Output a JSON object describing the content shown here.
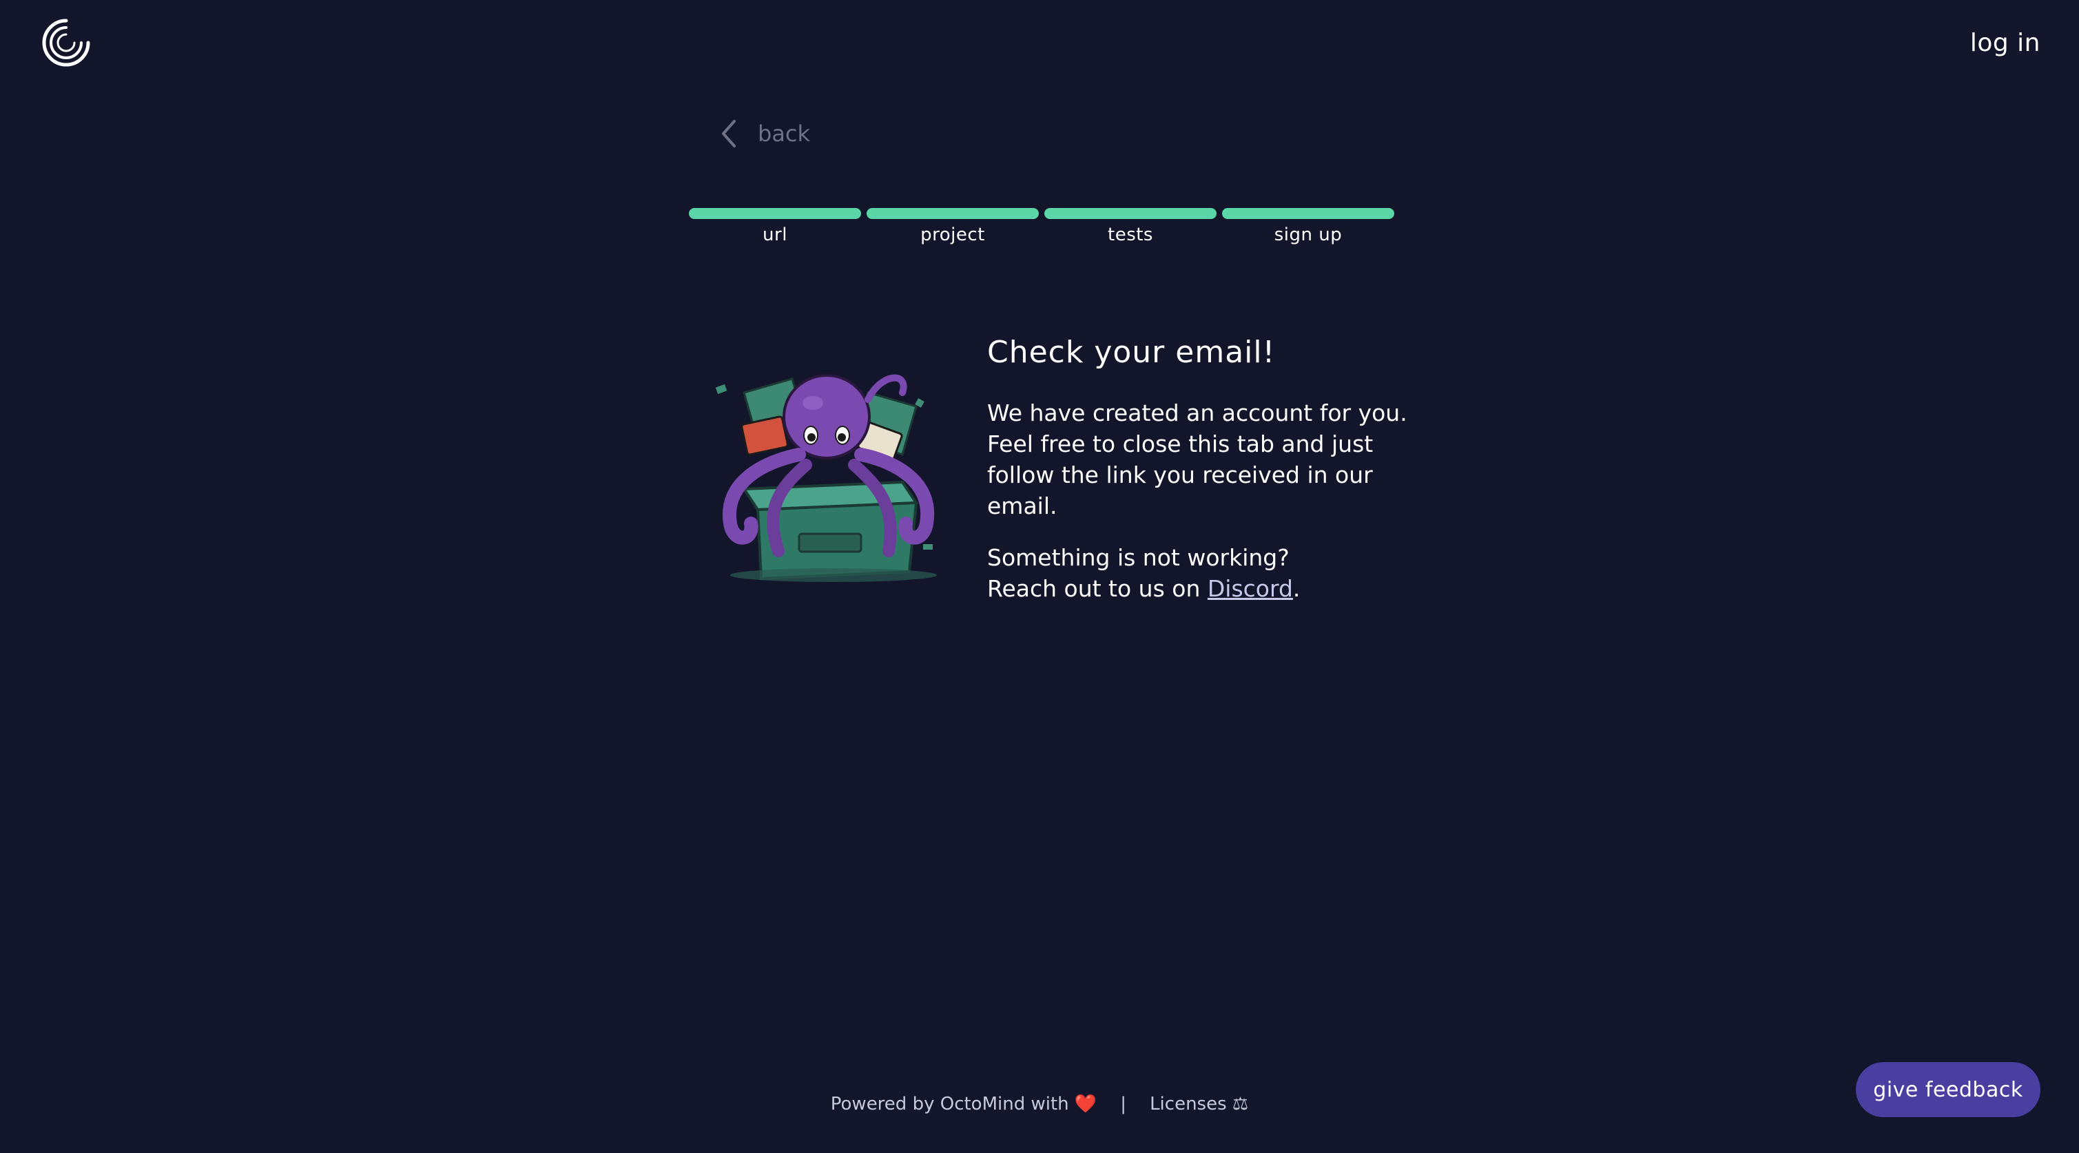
{
  "header": {
    "login_label": "log in"
  },
  "back": {
    "label": "back"
  },
  "steps": [
    {
      "label": "url",
      "complete": true
    },
    {
      "label": "project",
      "complete": true
    },
    {
      "label": "tests",
      "complete": true
    },
    {
      "label": "sign up",
      "complete": true
    }
  ],
  "main": {
    "title": "Check your email!",
    "paragraph1": "We have created an account for you. Feel free to close this tab and just follow the link you received in our email.",
    "paragraph2_line1": "Something is not working?",
    "paragraph2_line2_prefix": "Reach out to us on ",
    "discord_link": "Discord",
    "paragraph2_suffix": "."
  },
  "footer": {
    "powered_text": "Powered by OctoMind with",
    "heart": "❤️",
    "separator": "|",
    "licenses_label": "Licenses",
    "licenses_icon": "⚖"
  },
  "feedback_button": "give feedback",
  "colors": {
    "background": "#13152a",
    "progress": "#5ad6a7",
    "feedback_button": "#4a3fa0",
    "muted": "#6f7187"
  },
  "icons": {
    "logo": "octomind-logo-icon",
    "back": "chevron-left-icon",
    "illustration": "octopus-in-box-illustration"
  }
}
